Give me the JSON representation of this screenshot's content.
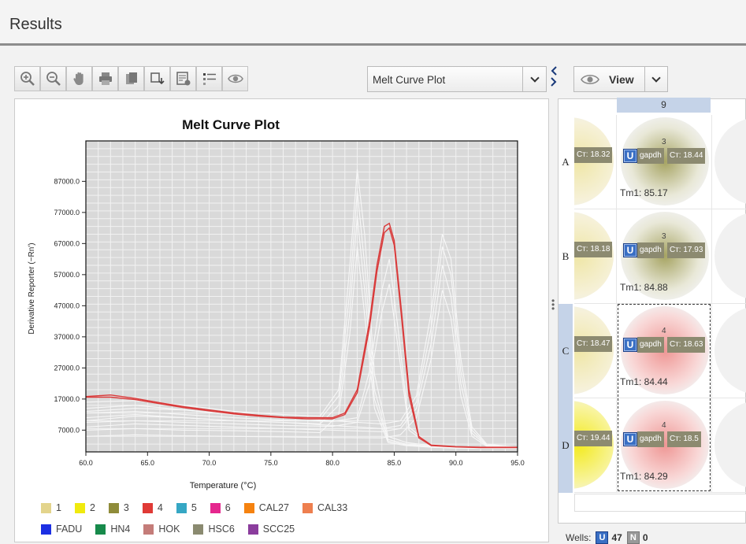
{
  "header": {
    "title": "Results"
  },
  "toolbar": {
    "buttons": [
      {
        "name": "zoom-in-icon"
      },
      {
        "name": "zoom-out-icon"
      },
      {
        "name": "hand-pan-icon"
      },
      {
        "name": "print-icon"
      },
      {
        "name": "copy-icon"
      },
      {
        "name": "export-icon"
      },
      {
        "name": "report-settings-icon"
      },
      {
        "name": "legend-list-icon"
      },
      {
        "name": "eye-icon"
      }
    ]
  },
  "plot_select": {
    "selected": "Melt Curve Plot"
  },
  "view_button": {
    "label": "View"
  },
  "chart_data": {
    "type": "line",
    "title": "Melt Curve Plot",
    "xlabel": "Temperature (°C)",
    "ylabel": "Derivative Reporter (−Rn')",
    "xlim": [
      60.0,
      95.0
    ],
    "ylim": [
      0,
      100000
    ],
    "x_ticks": [
      "60.0",
      "65.0",
      "70.0",
      "75.0",
      "80.0",
      "85.0",
      "90.0",
      "95.0"
    ],
    "x_tick_values": [
      60,
      65,
      70,
      75,
      80,
      85,
      90,
      95
    ],
    "y_ticks": [
      "7000.0",
      "17000.0",
      "27000.0",
      "37000.0",
      "47000.0",
      "57000.0",
      "67000.0",
      "77000.0",
      "87000.0"
    ],
    "y_tick_values": [
      7000,
      17000,
      27000,
      37000,
      47000,
      57000,
      67000,
      77000,
      87000
    ],
    "grid": true,
    "highlight_color": "#d93a3a",
    "background_color": "#d9d9d9",
    "series": [
      {
        "highlight": true,
        "x": [
          60,
          62,
          64,
          66,
          68,
          70,
          72,
          74,
          76,
          78,
          80,
          81,
          82,
          83,
          83.6,
          84.2,
          84.6,
          85,
          85.6,
          86.2,
          87,
          88,
          90,
          92,
          95
        ],
        "y": [
          17800,
          18300,
          17200,
          15800,
          14500,
          13500,
          12500,
          11800,
          11200,
          11000,
          11000,
          12500,
          20000,
          42000,
          60000,
          72500,
          73500,
          68000,
          45000,
          20000,
          5000,
          2200,
          1700,
          1500,
          1500
        ]
      },
      {
        "highlight": true,
        "x": [
          60,
          62,
          64,
          66,
          68,
          70,
          72,
          74,
          76,
          78,
          80,
          81,
          82,
          83,
          83.6,
          84.2,
          84.6,
          85,
          85.6,
          86.2,
          87,
          88,
          90,
          92,
          95
        ],
        "y": [
          17600,
          17600,
          16800,
          15500,
          14200,
          13200,
          12200,
          11500,
          11000,
          10600,
          10600,
          12000,
          19000,
          40000,
          58000,
          70500,
          72000,
          66500,
          43000,
          18000,
          4500,
          2000,
          1600,
          1400,
          1400
        ]
      },
      {
        "highlight": false,
        "x": [
          60,
          64,
          68,
          72,
          76,
          79,
          80.5,
          81.4,
          82,
          82.6,
          83.4,
          84.5,
          86,
          88,
          90,
          95
        ],
        "y": [
          16000,
          16500,
          15000,
          13000,
          12000,
          11500,
          20000,
          60000,
          91000,
          70000,
          25000,
          5000,
          3000,
          2000,
          1500,
          1400
        ]
      },
      {
        "highlight": false,
        "x": [
          60,
          64,
          68,
          72,
          76,
          79,
          80.5,
          81.4,
          82,
          82.6,
          83.4,
          84.5,
          86,
          88,
          90,
          95
        ],
        "y": [
          13000,
          14000,
          13500,
          12000,
          11000,
          10500,
          18000,
          52000,
          84000,
          60000,
          20000,
          4000,
          2500,
          1800,
          1400,
          1300
        ]
      },
      {
        "highlight": false,
        "x": [
          60,
          64,
          68,
          72,
          76,
          79,
          80.5,
          81.4,
          82,
          82.6,
          83.4,
          84.5,
          86,
          88,
          90,
          95
        ],
        "y": [
          10000,
          11500,
          11000,
          10000,
          9500,
          9000,
          15000,
          45000,
          76000,
          52000,
          17000,
          3500,
          2200,
          1700,
          1300,
          1200
        ]
      },
      {
        "highlight": false,
        "x": [
          60,
          64,
          68,
          72,
          76,
          79,
          80.5,
          81.4,
          82,
          82.6,
          83.4,
          84.5,
          86,
          88,
          90,
          95
        ],
        "y": [
          7000,
          7500,
          7000,
          6800,
          6500,
          6200,
          12000,
          38000,
          66000,
          44000,
          14000,
          3000,
          2000,
          1500,
          1200,
          1100
        ]
      },
      {
        "highlight": false,
        "x": [
          60,
          64,
          68,
          72,
          76,
          80,
          84,
          85.5,
          86.8,
          88,
          88.9,
          89.6,
          90.4,
          91.3,
          92.5,
          95
        ],
        "y": [
          14000,
          15000,
          13500,
          12000,
          11000,
          10000,
          9000,
          10000,
          18000,
          45000,
          70000,
          62000,
          30000,
          8000,
          2500,
          1500
        ]
      },
      {
        "highlight": false,
        "x": [
          60,
          64,
          68,
          72,
          76,
          80,
          84,
          85.5,
          86.8,
          88,
          88.9,
          89.6,
          90.4,
          91.3,
          92.5,
          95
        ],
        "y": [
          11000,
          12000,
          11000,
          10000,
          9500,
          8500,
          7500,
          8500,
          16000,
          40000,
          66000,
          57000,
          26000,
          7000,
          2200,
          1400
        ]
      },
      {
        "highlight": false,
        "x": [
          60,
          64,
          68,
          72,
          76,
          80,
          84,
          85.5,
          86.8,
          88,
          88.9,
          89.6,
          90.4,
          91.3,
          92.5,
          95
        ],
        "y": [
          8000,
          9000,
          8500,
          8000,
          7500,
          7000,
          6500,
          7500,
          14000,
          35000,
          60000,
          50000,
          22000,
          6000,
          2000,
          1300
        ]
      },
      {
        "highlight": false,
        "x": [
          60,
          64,
          68,
          72,
          76,
          80,
          84,
          85.5,
          86.8,
          88,
          88.9,
          89.6,
          90.4,
          91.3,
          92.5,
          95
        ],
        "y": [
          5000,
          5500,
          5200,
          5000,
          4800,
          4600,
          4500,
          5500,
          11000,
          30000,
          52000,
          43000,
          18000,
          5000,
          1800,
          1200
        ]
      },
      {
        "highlight": false,
        "x": [
          60,
          64,
          68,
          72,
          76,
          80,
          82,
          83,
          84,
          84.6,
          85.3,
          86.2,
          88,
          90,
          95
        ],
        "y": [
          12500,
          13000,
          12000,
          11000,
          10200,
          9800,
          11000,
          26000,
          52000,
          62000,
          40000,
          8000,
          2000,
          1500,
          1300
        ]
      },
      {
        "highlight": false,
        "x": [
          60,
          64,
          68,
          72,
          76,
          80,
          82,
          83,
          84,
          84.6,
          85.3,
          86.2,
          88,
          90,
          95
        ],
        "y": [
          9500,
          10000,
          9500,
          9000,
          8500,
          8200,
          9500,
          22000,
          45000,
          54000,
          34000,
          7000,
          1800,
          1400,
          1200
        ]
      }
    ],
    "legend": [
      {
        "label": "1",
        "color": "#e3d48c"
      },
      {
        "label": "2",
        "color": "#f0ea0e"
      },
      {
        "label": "3",
        "color": "#8f8c3a"
      },
      {
        "label": "4",
        "color": "#e03a36"
      },
      {
        "label": "5",
        "color": "#36a7c4"
      },
      {
        "label": "6",
        "color": "#e5278e"
      },
      {
        "label": "CAL27",
        "color": "#f5820f"
      },
      {
        "label": "CAL33",
        "color": "#ee7f4f"
      },
      {
        "label": "FADU",
        "color": "#1c2fe3"
      },
      {
        "label": "HN4",
        "color": "#178a4b"
      },
      {
        "label": "HOK",
        "color": "#c47c79"
      },
      {
        "label": "HSC6",
        "color": "#8a8a70"
      },
      {
        "label": "SCC25",
        "color": "#8b3d9d"
      }
    ]
  },
  "plate": {
    "column_header": "9",
    "rows": [
      {
        "label": "A",
        "left_ct": "Cт: 18.32",
        "sample": "3",
        "badge": "U",
        "target": "gapdh",
        "ct": "Cт: 18.44",
        "tm": "Tm1: 85.17",
        "color": "#8f8c3a"
      },
      {
        "label": "B",
        "left_ct": "Cт: 18.18",
        "sample": "3",
        "badge": "U",
        "target": "gapdh",
        "ct": "Cт: 17.93",
        "tm": "Tm1: 84.88",
        "color": "#8f8c3a"
      },
      {
        "label": "C",
        "left_ct": "Cт: 18.47",
        "sample": "4",
        "badge": "U",
        "target": "gapdh",
        "ct": "Cт: 18.63",
        "tm": "Tm1: 84.44",
        "color": "#e03a36"
      },
      {
        "label": "D",
        "left_ct": "Cт: 19.44",
        "sample": "4",
        "badge": "U",
        "target": "gapdh",
        "ct": "Cт: 18.5",
        "tm": "Tm1: 84.29",
        "color": "#e03a36"
      }
    ]
  },
  "footer": {
    "label": "Wells:",
    "unknown_badge": "U",
    "unknown_count": "47",
    "ntc_badge": "N",
    "ntc_count": "0"
  }
}
